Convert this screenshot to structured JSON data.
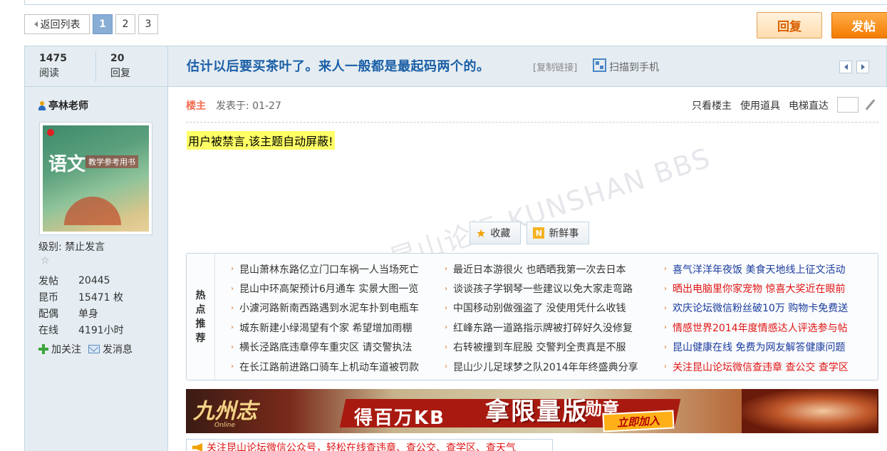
{
  "pager": {
    "back_label": "返回列表",
    "pages": [
      "1",
      "2",
      "3"
    ],
    "current": "1"
  },
  "actions": {
    "reply_label": "回复",
    "post_label": "发帖"
  },
  "thread": {
    "views_count": "1475",
    "views_label": "阅读",
    "replies_count": "20",
    "replies_label": "回复",
    "title": "估计以后要买茶叶了。来人一般都是最起码两个的。",
    "copy_link": "[复制链接]",
    "scan_label": "扫描到手机"
  },
  "user": {
    "name": "亭林老师",
    "avatar_title": "语文",
    "avatar_subtitle": "教学参考用书",
    "level": "级别: 禁止发言",
    "stats": [
      {
        "key": "发帖",
        "value": "20445"
      },
      {
        "key": "昆币",
        "value": "15471 枚"
      },
      {
        "key": "配偶",
        "value": "单身"
      },
      {
        "key": "在线",
        "value": "4191小时"
      }
    ],
    "follow_label": "加关注",
    "message_label": "发消息"
  },
  "post": {
    "owner_label": "楼主",
    "posted_at": "发表于: 01-27",
    "only_owner": "只看楼主",
    "use_tool": "使用道具",
    "elevator": "电梯直达",
    "banned_text": "用户被禁言,该主题自动屏蔽!",
    "favorite_label": "收藏",
    "news_label": "新鲜事",
    "watermark": "昆山论坛 KUNSHAN BBS"
  },
  "hot": {
    "label_chars": [
      "热",
      "点",
      "推",
      "荐"
    ],
    "col1": [
      "昆山萧林东路亿立门口车祸一人当场死亡",
      "昆山中环高架预计6月通车 实景大图一览",
      "小澞河路新南西路遇到水泥车扑到电瓶车",
      "城东新建小绿渴望有个家 希望增加雨棚",
      "横长泾路底违章停车重灾区 请交警执法",
      "在长江路前进路口骑车上机动车道被罚款"
    ],
    "col2": [
      "最近日本游很火 也晒晒我第一次去日本",
      "谈谈孩子学钢琴一些建议以免大家走弯路",
      "中国移动别做强盗了 没使用凭什么收钱",
      "红峰东路一道路指示牌被打碎好久没修复",
      "右转被撞到车屁股 交警判全责真是不服",
      "昆山少儿足球梦之队2014年年终盛典分享"
    ],
    "col3": [
      {
        "text": "喜气洋洋年夜饭 美食天地线上征文活动",
        "color": "blue"
      },
      {
        "text": "晒出电脑里你家宠物 惊喜大奖近在眼前",
        "color": "red"
      },
      {
        "text": "欢庆论坛微信粉丝破10万 购物卡免费送",
        "color": "blue"
      },
      {
        "text": "情感世界2014年度情感达人评选参与帖",
        "color": "red"
      },
      {
        "text": "昆山健康在线 免费为网友解答健康问题",
        "color": "blue"
      },
      {
        "text": "关注昆山论坛微信查违章 查公交 查学区",
        "color": "red"
      }
    ]
  },
  "ad": {
    "logo": "九州志",
    "logo_en": "Online",
    "line1": "得百万KB",
    "line2": "拿限量版",
    "line3": "勋章",
    "cta": "立即加入"
  },
  "notice": {
    "text": "关注昆山论坛微信公众号，轻松在线查违章、查公交、查学区、查天气"
  }
}
